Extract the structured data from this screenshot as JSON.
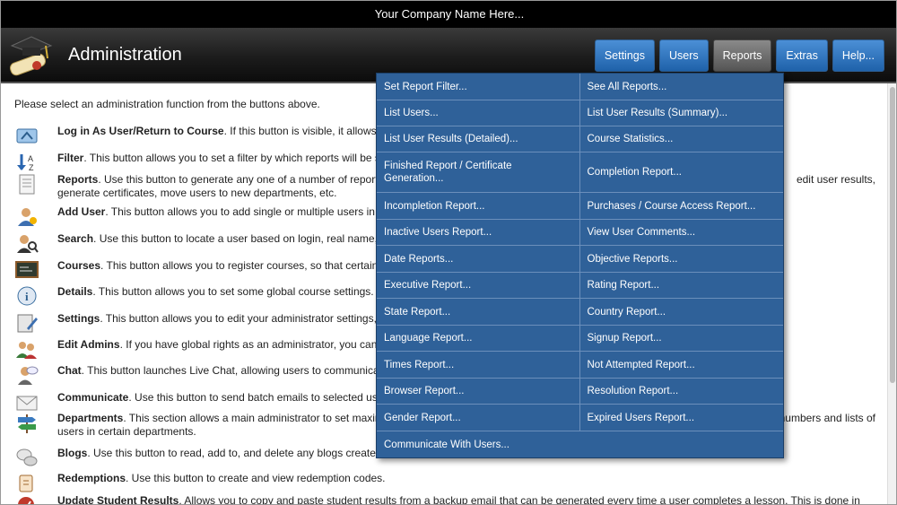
{
  "company_name": "Your Company Name Here...",
  "page_title": "Administration",
  "nav": [
    {
      "label": "Settings"
    },
    {
      "label": "Users"
    },
    {
      "label": "Reports",
      "active": true
    },
    {
      "label": "Extras"
    },
    {
      "label": "Help..."
    }
  ],
  "intro": "Please select an administration function from the buttons above.",
  "functions": [
    {
      "icon": "login-icon",
      "title": "Log in As User/Return to Course",
      "text": ". If this button is visible, it allows y"
    },
    {
      "icon": "sort-az-icon",
      "title": "Filter",
      "text": ". This button allows you to set a filter by which reports will be s"
    },
    {
      "icon": "document-icon",
      "title": "Reports",
      "text": ". Use this button to generate any one of a number of reports",
      "text_right": "edit user results,",
      "line2": "generate certificates, move users to new departments, etc."
    },
    {
      "icon": "add-user-icon",
      "title": "Add User",
      "text": ". This button allows you to add single or multiple users in c"
    },
    {
      "icon": "search-user-icon",
      "title": "Search",
      "text": ". Use this button to locate a user based on login, real name, u"
    },
    {
      "icon": "blackboard-icon",
      "title": "Courses",
      "text": ". This button allows you to register courses, so that certain c"
    },
    {
      "icon": "info-icon",
      "title": "Details",
      "text": ". This button allows you to set some global course settings."
    },
    {
      "icon": "settings-edit-icon",
      "title": "Settings",
      "text": ". This button allows you to edit your administrator settings,"
    },
    {
      "icon": "admins-icon",
      "title": "Edit Admins",
      "text": ". If you have global rights as an administrator, you can u"
    },
    {
      "icon": "chat-icon",
      "title": "Chat",
      "text": ". This button launches Live Chat, allowing users to communicate"
    },
    {
      "icon": "email-icon",
      "title": "Communicate",
      "text": ". Use this button to send batch emails to selected user"
    },
    {
      "icon": "signpost-icon",
      "title": "Departments",
      "text": ". This section allows a main administrator to set maxim",
      "text_right": "numbers and lists of",
      "line2": "users in certain departments."
    },
    {
      "icon": "blog-icon",
      "title": "Blogs",
      "text": ". Use this button to read, add to, and delete any blogs created"
    },
    {
      "icon": "redemption-icon",
      "title": "Redemptions",
      "text": ". Use this button to create and view redemption codes."
    },
    {
      "icon": "update-results-icon",
      "title": "Update Student Results",
      "text": ". Allows you to copy and paste student results from a backup email that can be generated every time a user completes a lesson. This is done in the case"
    }
  ],
  "reports_menu": [
    [
      "Set Report Filter...",
      "See All Reports..."
    ],
    [
      "List Users...",
      "List User Results (Summary)..."
    ],
    [
      "List User Results (Detailed)...",
      "Course Statistics..."
    ],
    [
      "Finished Report / Certificate Generation...",
      "Completion Report..."
    ],
    [
      "Incompletion Report...",
      "Purchases / Course Access Report..."
    ],
    [
      "Inactive Users Report...",
      "View User Comments..."
    ],
    [
      "Date Reports...",
      "Objective Reports..."
    ],
    [
      "Executive Report...",
      "Rating Report..."
    ],
    [
      "State Report...",
      "Country Report..."
    ],
    [
      "Language Report...",
      "Signup Report..."
    ],
    [
      "Times Report...",
      "Not Attempted Report..."
    ],
    [
      "Browser Report...",
      "Resolution Report..."
    ],
    [
      "Gender Report...",
      "Expired Users Report..."
    ],
    [
      "Communicate With Users..."
    ]
  ],
  "colors": {
    "nav_blue": "#2f6fb8",
    "nav_active": "#666666",
    "menu_bg": "#2f6199"
  }
}
